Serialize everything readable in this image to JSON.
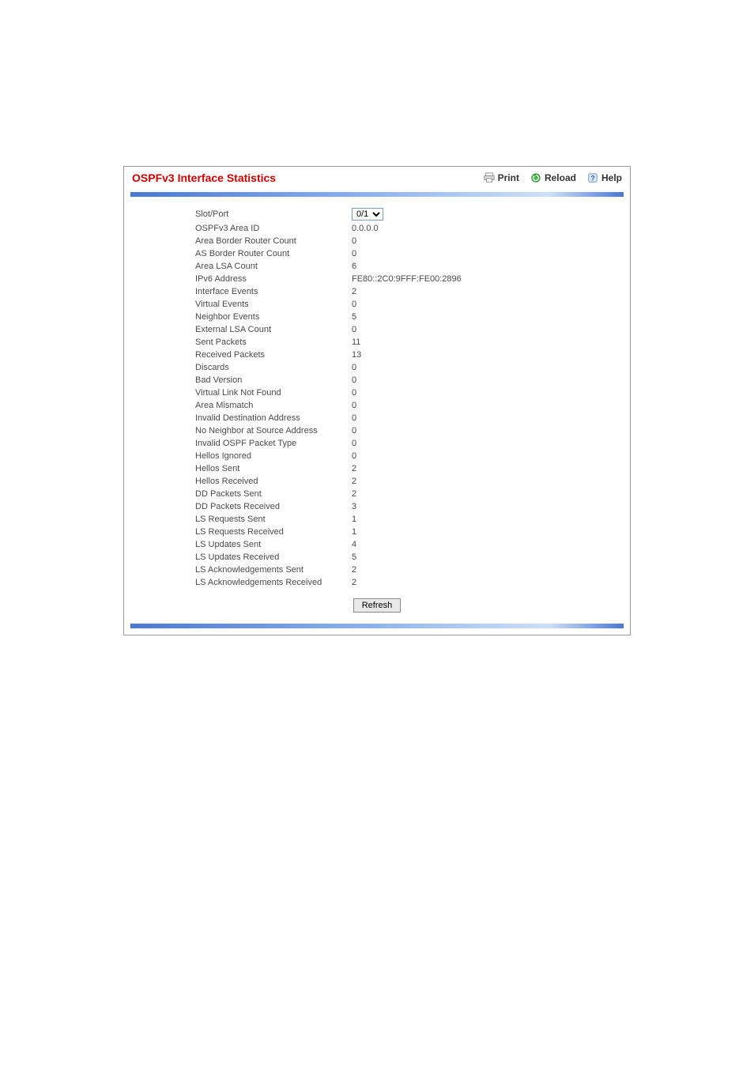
{
  "header": {
    "title": "OSPFv3 Interface Statistics",
    "print": "Print",
    "reload": "Reload",
    "help": "Help"
  },
  "select": {
    "label": "Slot/Port",
    "value": "0/1"
  },
  "rows": [
    {
      "label": "OSPFv3 Area ID",
      "value": "0.0.0.0"
    },
    {
      "label": "Area Border Router Count",
      "value": "0"
    },
    {
      "label": "AS Border Router Count",
      "value": "0"
    },
    {
      "label": "Area LSA Count",
      "value": "6"
    },
    {
      "label": "IPv6 Address",
      "value": "FE80::2C0:9FFF:FE00:2896"
    },
    {
      "label": "Interface Events",
      "value": "2"
    },
    {
      "label": "Virtual Events",
      "value": "0"
    },
    {
      "label": "Neighbor Events",
      "value": "5"
    },
    {
      "label": "External LSA Count",
      "value": "0"
    },
    {
      "label": "Sent Packets",
      "value": "11"
    },
    {
      "label": "Received Packets",
      "value": "13"
    },
    {
      "label": "Discards",
      "value": "0"
    },
    {
      "label": "Bad Version",
      "value": "0"
    },
    {
      "label": "Virtual Link Not Found",
      "value": "0"
    },
    {
      "label": "Area Mismatch",
      "value": "0"
    },
    {
      "label": "Invalid Destination Address",
      "value": "0"
    },
    {
      "label": "No Neighbor at Source Address",
      "value": "0"
    },
    {
      "label": "Invalid OSPF Packet Type",
      "value": "0"
    },
    {
      "label": "Hellos Ignored",
      "value": "0"
    },
    {
      "label": "Hellos Sent",
      "value": "2"
    },
    {
      "label": "Hellos Received",
      "value": "2"
    },
    {
      "label": "DD Packets Sent",
      "value": "2"
    },
    {
      "label": "DD Packets Received",
      "value": "3"
    },
    {
      "label": "LS Requests Sent",
      "value": "1"
    },
    {
      "label": "LS Requests Received",
      "value": "1"
    },
    {
      "label": "LS Updates Sent",
      "value": "4"
    },
    {
      "label": "LS Updates Received",
      "value": "5"
    },
    {
      "label": "LS Acknowledgements Sent",
      "value": "2"
    },
    {
      "label": "LS Acknowledgements Received",
      "value": "2"
    }
  ],
  "buttons": {
    "refresh": "Refresh"
  }
}
